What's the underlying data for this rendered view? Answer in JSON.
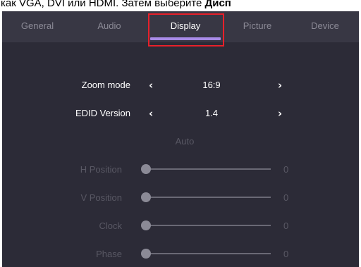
{
  "caption": {
    "text": "как VGA, DVI или HDMI. Затем выберите ",
    "bold": "Дисп"
  },
  "tabs": [
    {
      "label": "General",
      "active": false
    },
    {
      "label": "Audio",
      "active": false
    },
    {
      "label": "Display",
      "active": true
    },
    {
      "label": "Picture",
      "active": false
    },
    {
      "label": "Device",
      "active": false
    }
  ],
  "settings": {
    "zoom_mode": {
      "label": "Zoom mode",
      "value": "16:9"
    },
    "edid_version": {
      "label": "EDID Version",
      "value": "1.4"
    },
    "auto": {
      "label": "Auto"
    }
  },
  "sliders": [
    {
      "label": "H Position",
      "value": "0"
    },
    {
      "label": "V Position",
      "value": "0"
    },
    {
      "label": "Clock",
      "value": "0"
    },
    {
      "label": "Phase",
      "value": "0"
    }
  ],
  "icons": {
    "prev": "chevron-left-icon",
    "next": "chevron-right-icon"
  },
  "colors": {
    "highlight": "#e8202a",
    "accent": "#a88be8",
    "background": "#2c2b37",
    "tabbar": "#383744"
  }
}
